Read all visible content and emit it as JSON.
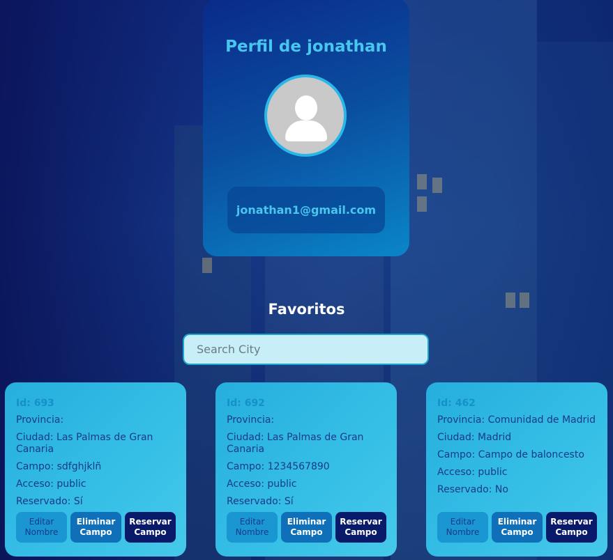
{
  "profile": {
    "title": "Perfil de jonathan",
    "email": "jonathan1@gmail.com",
    "avatar_icon": "user-icon"
  },
  "favorites": {
    "title": "Favoritos",
    "search_placeholder": "Search City",
    "cards": [
      {
        "id": "Id: 693",
        "provincia": "Provincia:",
        "ciudad": "Ciudad: Las Palmas de Gran Canaria",
        "campo": "Campo: sdfghjklñ",
        "acceso": "Acceso: public",
        "reservado": "Reservado: Sí",
        "edit_label": "Editar Nombre",
        "delete_label": "Eliminar Campo",
        "reserve_label": "Reservar Campo"
      },
      {
        "id": "Id: 692",
        "provincia": "Provincia:",
        "ciudad": "Ciudad: Las Palmas de Gran Canaria",
        "campo": "Campo: 1234567890",
        "acceso": "Acceso: public",
        "reservado": "Reservado: Sí",
        "edit_label": "Editar Nombre",
        "delete_label": "Eliminar Campo",
        "reserve_label": "Reservar Campo"
      },
      {
        "id": "Id: 462",
        "provincia": "Provincia: Comunidad de Madrid",
        "ciudad": "Ciudad: Madrid",
        "campo": "Campo: Campo de baloncesto",
        "acceso": "Acceso: public",
        "reservado": "Reservado: No",
        "edit_label": "Editar Nombre",
        "delete_label": "Eliminar Campo",
        "reserve_label": "Reservar Campo"
      }
    ]
  },
  "colors": {
    "accent": "#49c6ee",
    "card": "#36bfe6",
    "reserve_button": "#0a1a6a",
    "delete_button": "#0f6fb8",
    "edit_button": "#1a96d2"
  }
}
